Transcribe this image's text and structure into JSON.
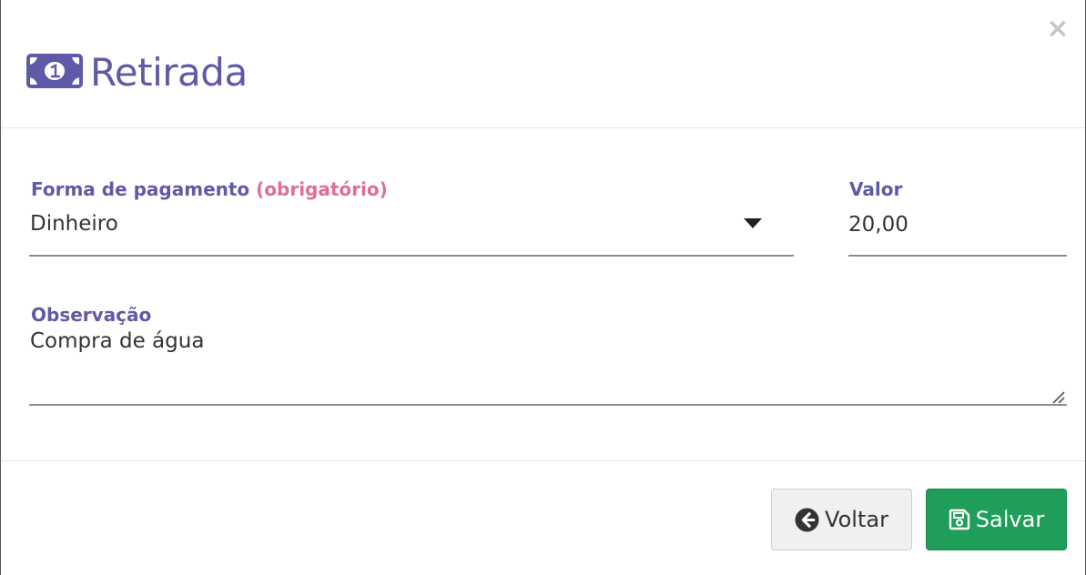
{
  "modal": {
    "title": "Retirada",
    "title_icon": "money-bill-icon",
    "close_symbol": "×"
  },
  "form": {
    "payment_method": {
      "label": "Forma de pagamento",
      "required_text": "(obrigatório)",
      "value": "Dinheiro"
    },
    "amount": {
      "label": "Valor",
      "value": "20,00"
    },
    "note": {
      "label": "Observação",
      "value": "Compra de água"
    }
  },
  "footer": {
    "back_label": "Voltar",
    "save_label": "Salvar"
  },
  "colors": {
    "accent": "#5f5aa7",
    "required": "#e06d98",
    "save_button": "#1f9e5a",
    "back_button": "#f0f0f0"
  }
}
